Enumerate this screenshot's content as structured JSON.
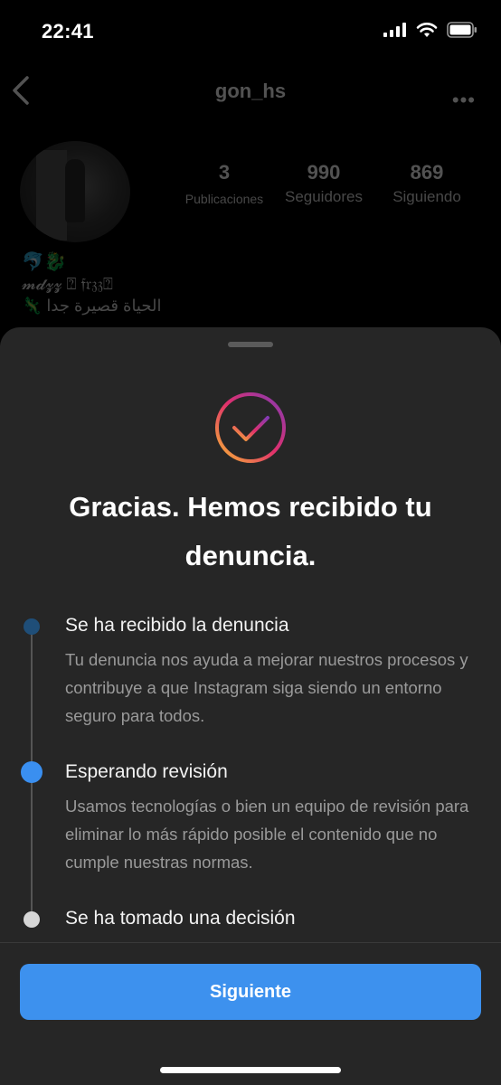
{
  "status_bar": {
    "time": "22:41",
    "icons": [
      "cellular-signal-icon",
      "wifi-icon",
      "battery-icon"
    ]
  },
  "profile": {
    "username": "gon_hs",
    "stats": [
      {
        "value": "3",
        "label": "Publicaciones"
      },
      {
        "value": "990",
        "label": "Seguidores"
      },
      {
        "value": "869",
        "label": "Siguiendo"
      }
    ],
    "bio_lines": [
      "🐬🐉",
      "𝓶𝓭𝔃𝔃 ⍰ 𝔣𝔯𝔷𝔷⍰",
      "🦎 الحياة قصيرة جدا"
    ]
  },
  "sheet": {
    "title": "Gracias. Hemos recibido tu denuncia.",
    "steps": [
      {
        "title": "Se ha recibido la denuncia",
        "description": "Tu denuncia nos ayuda a mejorar nuestros procesos y contribuye a que Instagram siga siendo un entorno seguro para todos.",
        "state": "done"
      },
      {
        "title": "Esperando revisión",
        "description": "Usamos tecnologías o bien un equipo de revisión para eliminar lo más rápido posible el contenido que no cumple nuestras normas.",
        "state": "active"
      },
      {
        "title": "Se ha tomado una decisión",
        "description": "",
        "state": "pending"
      }
    ],
    "next_label": "Siguiente"
  },
  "colors": {
    "accent_blue": "#3d91ee",
    "sheet_bg": "#262626",
    "check_gradient": [
      "#f7b733",
      "#e1306c",
      "#833ab4"
    ]
  }
}
